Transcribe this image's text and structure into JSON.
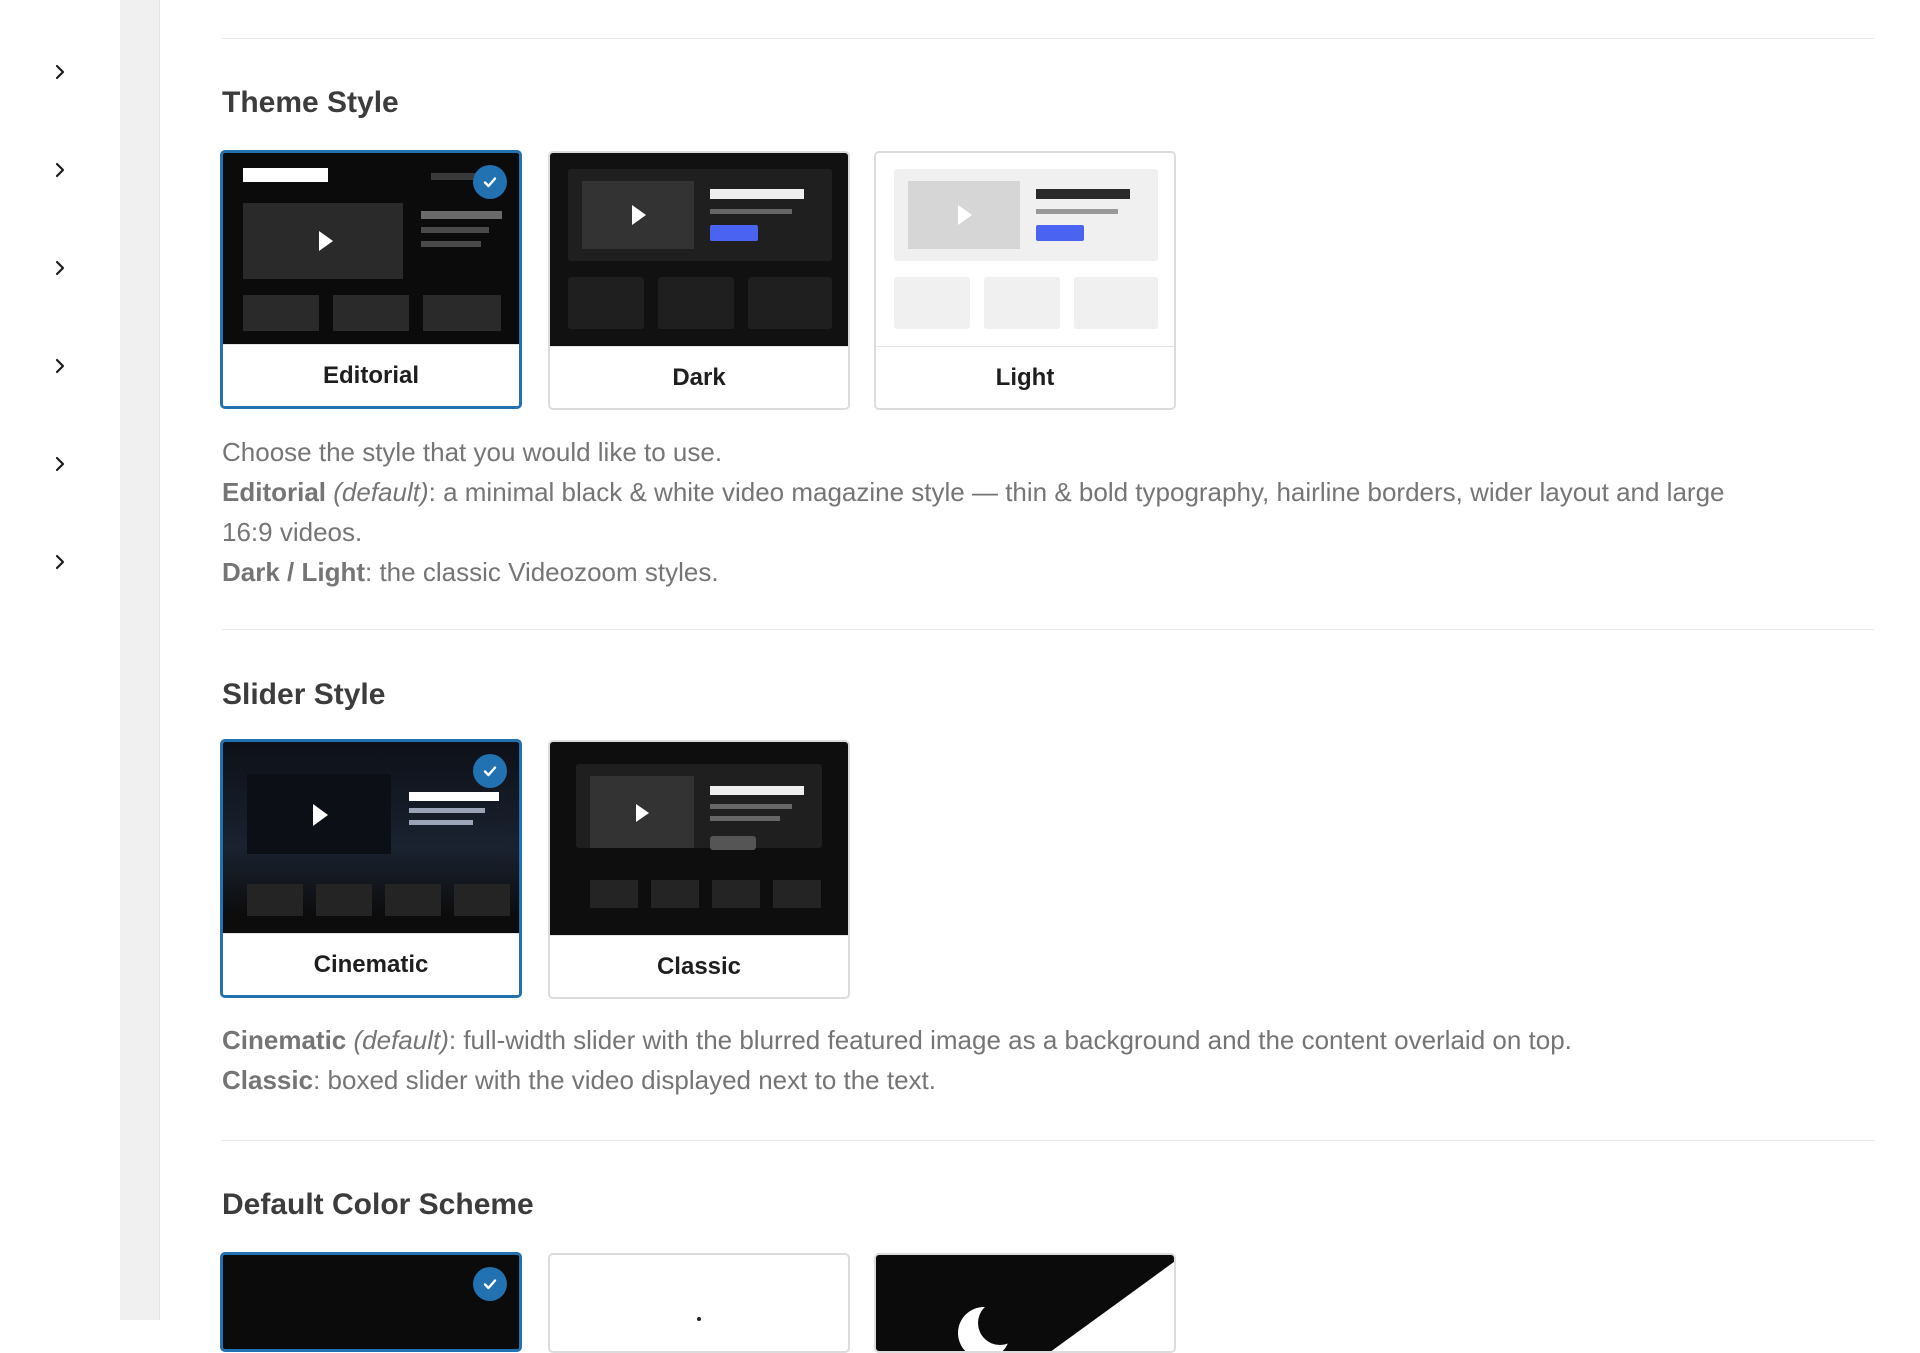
{
  "sidebar": {
    "chevrons": [
      "chevron-right-icon",
      "chevron-right-icon",
      "chevron-right-icon",
      "chevron-right-icon",
      "chevron-right-icon",
      "chevron-right-icon"
    ]
  },
  "theme_style": {
    "title": "Theme Style",
    "options": [
      {
        "label": "Editorial",
        "selected": true
      },
      {
        "label": "Dark",
        "selected": false
      },
      {
        "label": "Light",
        "selected": false
      }
    ],
    "desc_intro": "Choose the style that you would like to use.",
    "editorial_name": "Editorial",
    "editorial_default": "(default)",
    "editorial_text": ": a minimal black & white video magazine style — thin & bold typography, hairline borders, wider layout and large 16:9 videos.",
    "darklight_name": "Dark / Light",
    "darklight_text": ": the classic Videozoom styles."
  },
  "slider_style": {
    "title": "Slider Style",
    "options": [
      {
        "label": "Cinematic",
        "selected": true
      },
      {
        "label": "Classic",
        "selected": false
      }
    ],
    "cinematic_name": "Cinematic",
    "cinematic_default": "(default)",
    "cinematic_text": ": full-width slider with the blurred featured image as a background and the content overlaid on top.",
    "classic_name": "Classic",
    "classic_text": ": boxed slider with the video displayed next to the text."
  },
  "color_scheme": {
    "title": "Default Color Scheme"
  },
  "colors": {
    "accent": "#2271b1",
    "button_blue": "#4a63f0"
  }
}
